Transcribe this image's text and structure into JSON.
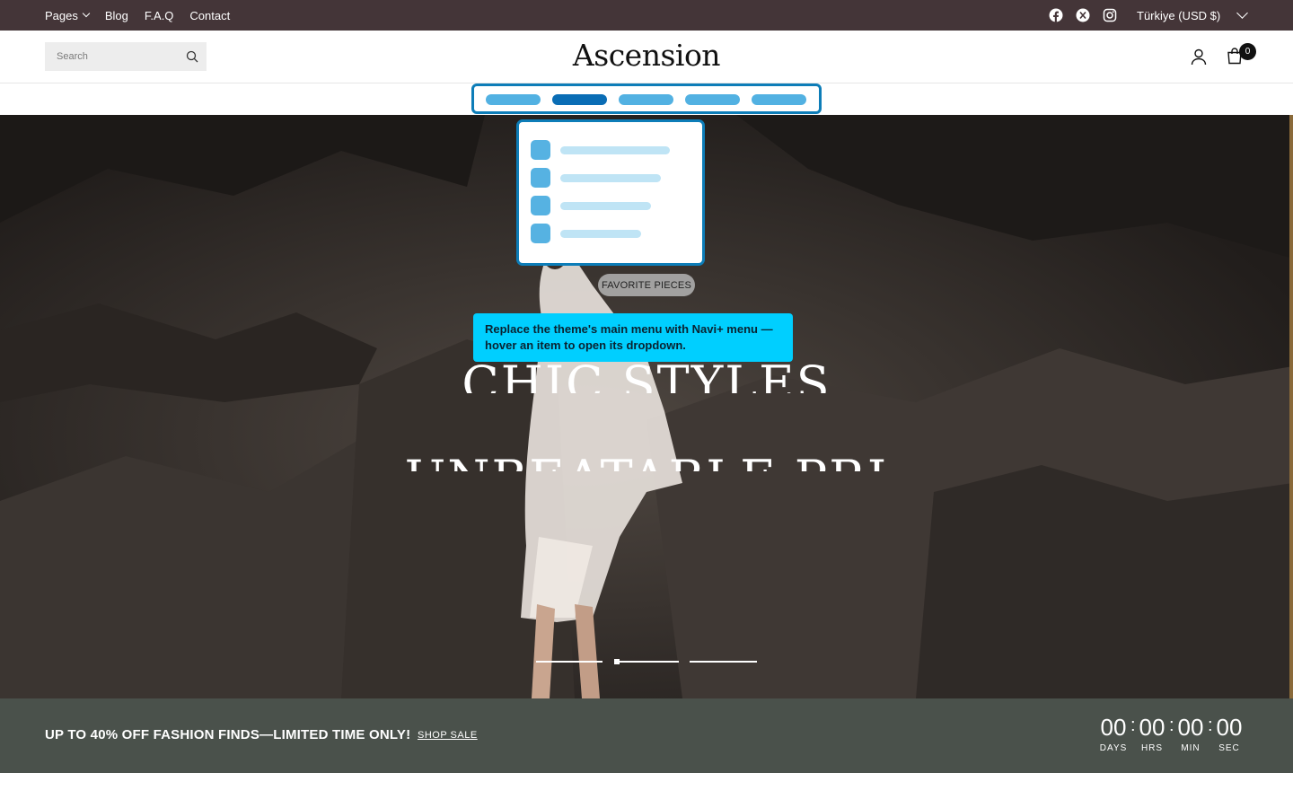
{
  "topbar": {
    "nav": [
      "Pages",
      "Blog",
      "F.A.Q",
      "Contact"
    ],
    "currency": "Türkiye (USD $)",
    "social_icons": [
      "facebook-icon",
      "x-icon",
      "instagram-icon"
    ]
  },
  "header": {
    "search_placeholder": "Search",
    "logo": "Ascension",
    "cart_count": "0"
  },
  "navi_menu": {
    "item_count": 5,
    "active_index": 1
  },
  "hero": {
    "badge": "FAVORITE PIECES",
    "tooltip": "Replace the theme's main menu with Navi+ menu — hover an item to open its dropdown.",
    "headline1": "CHIC STYLES",
    "headline2": "UNBEATABLE PRI",
    "slides": 3,
    "active_slide": 1
  },
  "promo": {
    "text": "UP TO 40% OFF FASHION FINDS—LIMITED TIME ONLY!",
    "link": "SHOP SALE",
    "countdown": [
      {
        "value": "00",
        "label": "DAYS"
      },
      {
        "value": "00",
        "label": "HRS"
      },
      {
        "value": "00",
        "label": "MIN"
      },
      {
        "value": "00",
        "label": "SEC"
      }
    ]
  },
  "colors": {
    "topbar": "#443538",
    "promo": "#4a514b",
    "navi_accent": "#0d7db8",
    "tooltip": "#00cfff"
  }
}
